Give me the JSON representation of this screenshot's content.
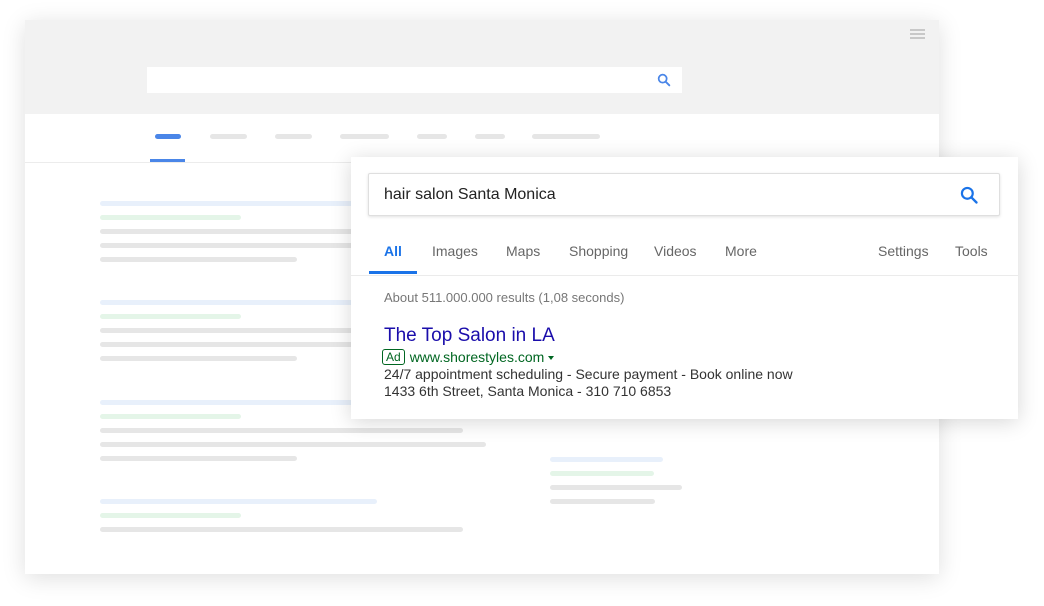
{
  "search": {
    "query": "hair salon Santa Monica"
  },
  "tabs": [
    {
      "label": "All",
      "active": true
    },
    {
      "label": "Images"
    },
    {
      "label": "Maps"
    },
    {
      "label": "Shopping"
    },
    {
      "label": "Videos"
    },
    {
      "label": "More"
    },
    {
      "label": "Settings"
    },
    {
      "label": "Tools"
    }
  ],
  "results_count": "About 511.000.000 results (1,08 seconds)",
  "ad_result": {
    "title": "The Top Salon in LA",
    "ad_label": "Ad",
    "url": "www.shorestyles.com",
    "description_line1": "24/7 appointment scheduling - Secure payment - Book online now",
    "description_line2": "1433 6th Street, Santa Monica - 310 710 6853"
  },
  "colors": {
    "accent_blue": "#1a73e8",
    "link_title": "#1a0dab",
    "url_green": "#006621",
    "skeleton_blue": "#e8f0fb",
    "skeleton_green": "#e4f5e8",
    "skeleton_gray": "#e6e6e6"
  },
  "icons": {
    "search": "search-icon",
    "menu": "menu-icon",
    "dropdown": "caret-down-icon"
  }
}
